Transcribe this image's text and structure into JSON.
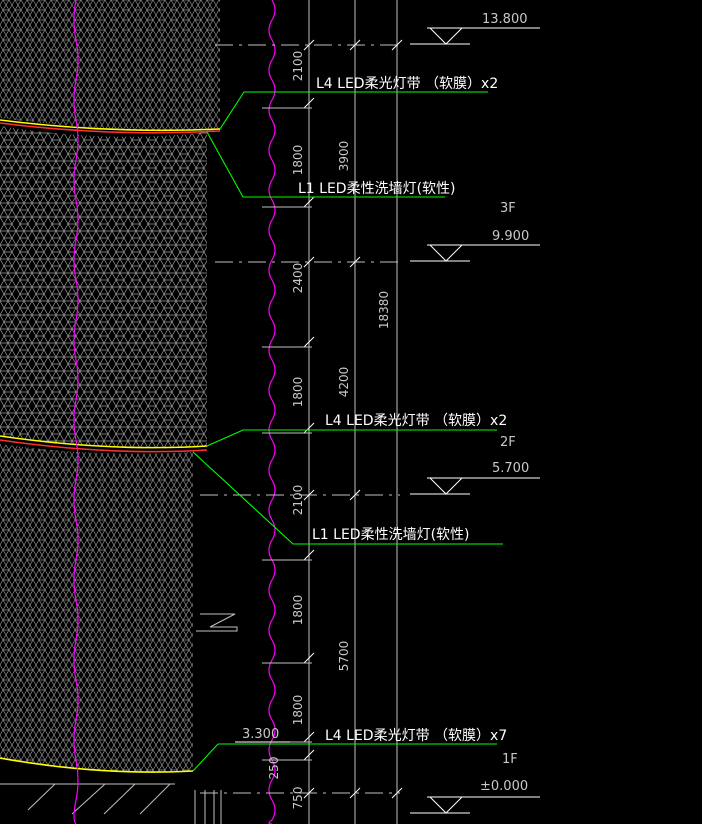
{
  "levels": [
    {
      "id": "top",
      "elevation": "13.800",
      "floor": ""
    },
    {
      "id": "3f",
      "elevation": "9.900",
      "floor": "3F"
    },
    {
      "id": "2f",
      "elevation": "5.700",
      "floor": "2F"
    },
    {
      "id": "1f",
      "elevation": "±0.000",
      "floor": "1F"
    }
  ],
  "callouts": [
    {
      "id": "c1",
      "text": "L4  LED柔光灯带  （软膜）x2"
    },
    {
      "id": "c2",
      "text": "L1  LED柔性洗墙灯(软性)"
    },
    {
      "id": "c3",
      "text": "L4  LED柔光灯带  （软膜）x2"
    },
    {
      "id": "c4",
      "text": "L1  LED柔性洗墙灯(软性)"
    },
    {
      "id": "c5",
      "text": "L4  LED柔光灯带  （软膜）x7"
    }
  ],
  "dimensions": {
    "inner": [
      "2100",
      "1800",
      "2400",
      "1800",
      "2100",
      "1800",
      "1800",
      "750"
    ],
    "inner_small": "250",
    "middle": [
      "3900",
      "4200",
      "5700"
    ],
    "total": "18380",
    "side_elevation": "3.300"
  },
  "colors": {
    "background": "#000000",
    "leader": "#00ff00",
    "axis": "#ff00ff",
    "curve_top": "#ffff00",
    "curve_bottom": "#ff3030",
    "pattern": "#9a9a9a",
    "dim_line": "#bfbfbf"
  }
}
